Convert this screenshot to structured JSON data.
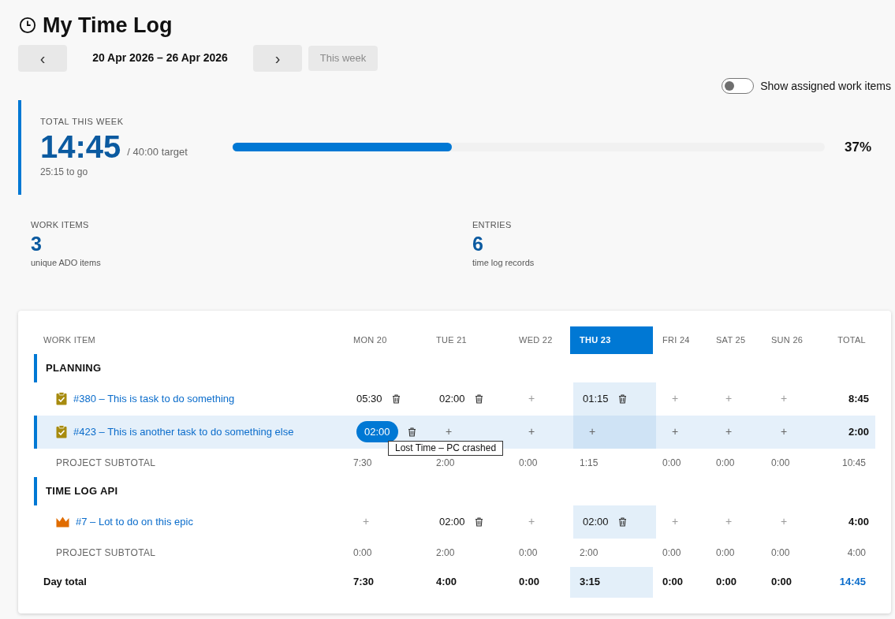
{
  "title": "My Time Log",
  "nav": {
    "prev": "‹",
    "range": "20 Apr 2026 – 26 Apr 2026",
    "next": "›",
    "this_week": {
      "label": "This week",
      "disabled": true
    }
  },
  "toggle": {
    "label": "Show assigned work items",
    "on": false
  },
  "summary": {
    "label": "TOTAL THIS WEEK",
    "total": "14:45",
    "target": "/ 40:00 target",
    "remaining": "25:15 to go",
    "level": 0.37,
    "percent": "37%"
  },
  "stats": [
    {
      "label": "WORK ITEMS",
      "value": "3",
      "caption": "unique ADO items"
    },
    {
      "label": "ENTRIES",
      "value": "6",
      "caption": "time log records"
    }
  ],
  "table": {
    "columns": [
      {
        "label": "WORK ITEM",
        "today": false
      },
      {
        "label": "MON 20",
        "today": false
      },
      {
        "label": "TUE 21",
        "today": false
      },
      {
        "label": "WED 22",
        "today": false
      },
      {
        "label": "THU 23",
        "today": true
      },
      {
        "label": "FRI 24",
        "today": false
      },
      {
        "label": "SAT 25",
        "today": false
      },
      {
        "label": "SUN 26",
        "today": false
      },
      {
        "label": "TOTAL",
        "today": false
      }
    ],
    "add_symbol": "+",
    "projects": [
      {
        "name": "PLANNING",
        "items": [
          {
            "kind": "task",
            "title": "#380 – This is task to do something",
            "selected": false,
            "total": "8:45",
            "cells": [
              {
                "kind": "entry",
                "value": "05:30",
                "active": false
              },
              {
                "kind": "entry",
                "value": "02:00",
                "active": false
              },
              {
                "kind": "empty"
              },
              {
                "kind": "entry",
                "value": "01:15",
                "active": false
              },
              {
                "kind": "empty"
              },
              {
                "kind": "empty"
              },
              {
                "kind": "empty"
              }
            ]
          },
          {
            "kind": "task",
            "title": "#423 – This is another task to do something else",
            "selected": true,
            "total": "2:00",
            "cells": [
              {
                "kind": "entry",
                "value": "02:00",
                "active": true,
                "tooltip": "Lost Time – PC crashed"
              },
              {
                "kind": "empty"
              },
              {
                "kind": "empty"
              },
              {
                "kind": "empty"
              },
              {
                "kind": "empty"
              },
              {
                "kind": "empty"
              },
              {
                "kind": "empty"
              }
            ]
          }
        ],
        "subtotal": {
          "label": "PROJECT SUBTOTAL",
          "values": [
            "7:30",
            "2:00",
            "0:00",
            "1:15",
            "0:00",
            "0:00",
            "0:00"
          ],
          "total": "10:45"
        }
      },
      {
        "name": "TIME LOG API",
        "items": [
          {
            "kind": "epic",
            "title": "#7 – Lot to do on this epic",
            "selected": false,
            "total": "4:00",
            "cells": [
              {
                "kind": "empty"
              },
              {
                "kind": "entry",
                "value": "02:00",
                "active": false
              },
              {
                "kind": "empty"
              },
              {
                "kind": "entry",
                "value": "02:00",
                "active": false
              },
              {
                "kind": "empty"
              },
              {
                "kind": "empty"
              },
              {
                "kind": "empty"
              }
            ]
          }
        ],
        "subtotal": {
          "label": "PROJECT SUBTOTAL",
          "values": [
            "0:00",
            "2:00",
            "0:00",
            "2:00",
            "0:00",
            "0:00",
            "0:00"
          ],
          "total": "4:00"
        }
      }
    ],
    "day_total": {
      "label": "Day total",
      "values": [
        "7:30",
        "4:00",
        "0:00",
        "3:15",
        "0:00",
        "0:00",
        "0:00"
      ],
      "total": "14:45"
    }
  }
}
